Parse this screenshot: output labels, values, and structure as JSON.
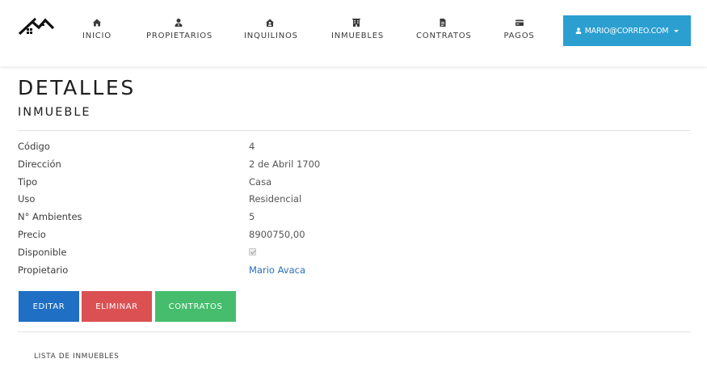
{
  "nav": {
    "logo_icon": "house-logo-icon",
    "items": [
      {
        "label": "INICIO",
        "icon": "home-icon"
      },
      {
        "label": "PROPIETARIOS",
        "icon": "user-tie-icon"
      },
      {
        "label": "INQUILINOS",
        "icon": "house-user-icon"
      },
      {
        "label": "INMUEBLES",
        "icon": "building-icon"
      },
      {
        "label": "CONTRATOS",
        "icon": "file-icon"
      },
      {
        "label": "PAGOS",
        "icon": "credit-card-icon"
      }
    ],
    "user": {
      "label": "MARIO@CORREO.COM",
      "icon": "user-icon",
      "color": "#2b9fd0"
    }
  },
  "page": {
    "title": "DETALLES",
    "subtitle": "INMUEBLE"
  },
  "details": {
    "codigo": {
      "label": "Código",
      "value": "4"
    },
    "direccion": {
      "label": "Dirección",
      "value": "2 de Abril 1700"
    },
    "tipo": {
      "label": "Tipo",
      "value": "Casa"
    },
    "uso": {
      "label": "Uso",
      "value": "Residencial"
    },
    "ambientes": {
      "label": "N° Ambientes",
      "value": "5"
    },
    "precio": {
      "label": "Precio",
      "value": "8900750,00"
    },
    "disponible": {
      "label": "Disponible",
      "checked": true
    },
    "propietario": {
      "label": "Propietario",
      "value": "Mario Avaca"
    }
  },
  "actions": {
    "edit": {
      "label": "EDITAR",
      "color": "#1f6fc4"
    },
    "delete": {
      "label": "ELIMINAR",
      "color": "#db5153"
    },
    "contracts": {
      "label": "CONTRATOS",
      "color": "#46bd6c"
    }
  },
  "footer": {
    "back_link": "LISTA DE INMUEBLES"
  }
}
